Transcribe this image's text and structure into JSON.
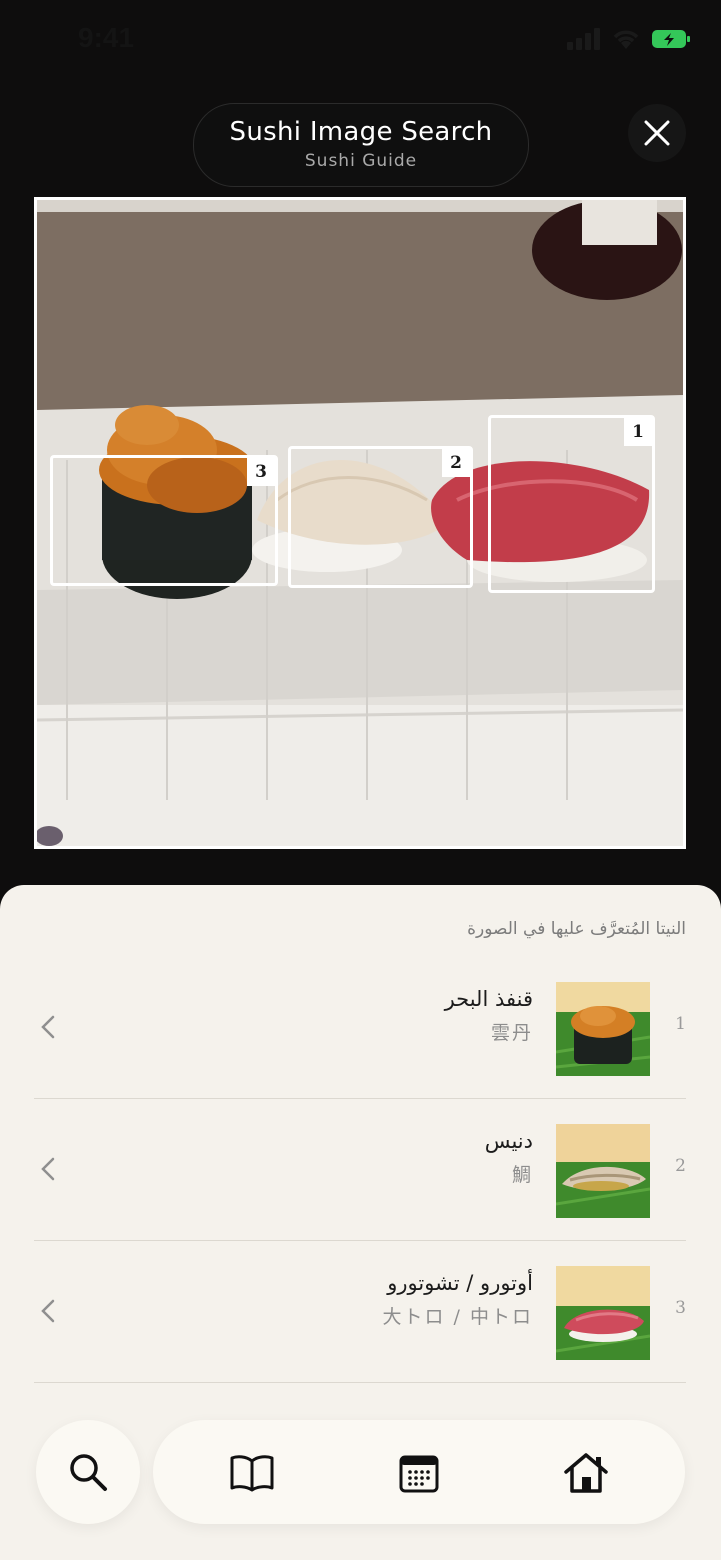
{
  "status_bar": {
    "time": "9:41"
  },
  "header": {
    "title": "Sushi Image Search",
    "subtitle": "Sushi Guide"
  },
  "detections": [
    {
      "number": "1"
    },
    {
      "number": "2"
    },
    {
      "number": "3"
    }
  ],
  "results": {
    "heading": "النيتا المُتعرَّف عليها في الصورة",
    "items": [
      {
        "number": "1",
        "name": "قنفذ البحر",
        "japanese": "雲丹"
      },
      {
        "number": "2",
        "name": "دنيس",
        "japanese": "鯛"
      },
      {
        "number": "3",
        "name": "أوتورو / تشوتورو",
        "japanese": "大トロ / 中トロ"
      }
    ]
  },
  "nav": {
    "icons": [
      "search-icon",
      "book-icon",
      "calendar-icon",
      "home-icon"
    ]
  },
  "colors": {
    "sheet_bg": "#f5f2ec",
    "dark_bg": "#0e0d0d",
    "battery": "#34c759"
  }
}
